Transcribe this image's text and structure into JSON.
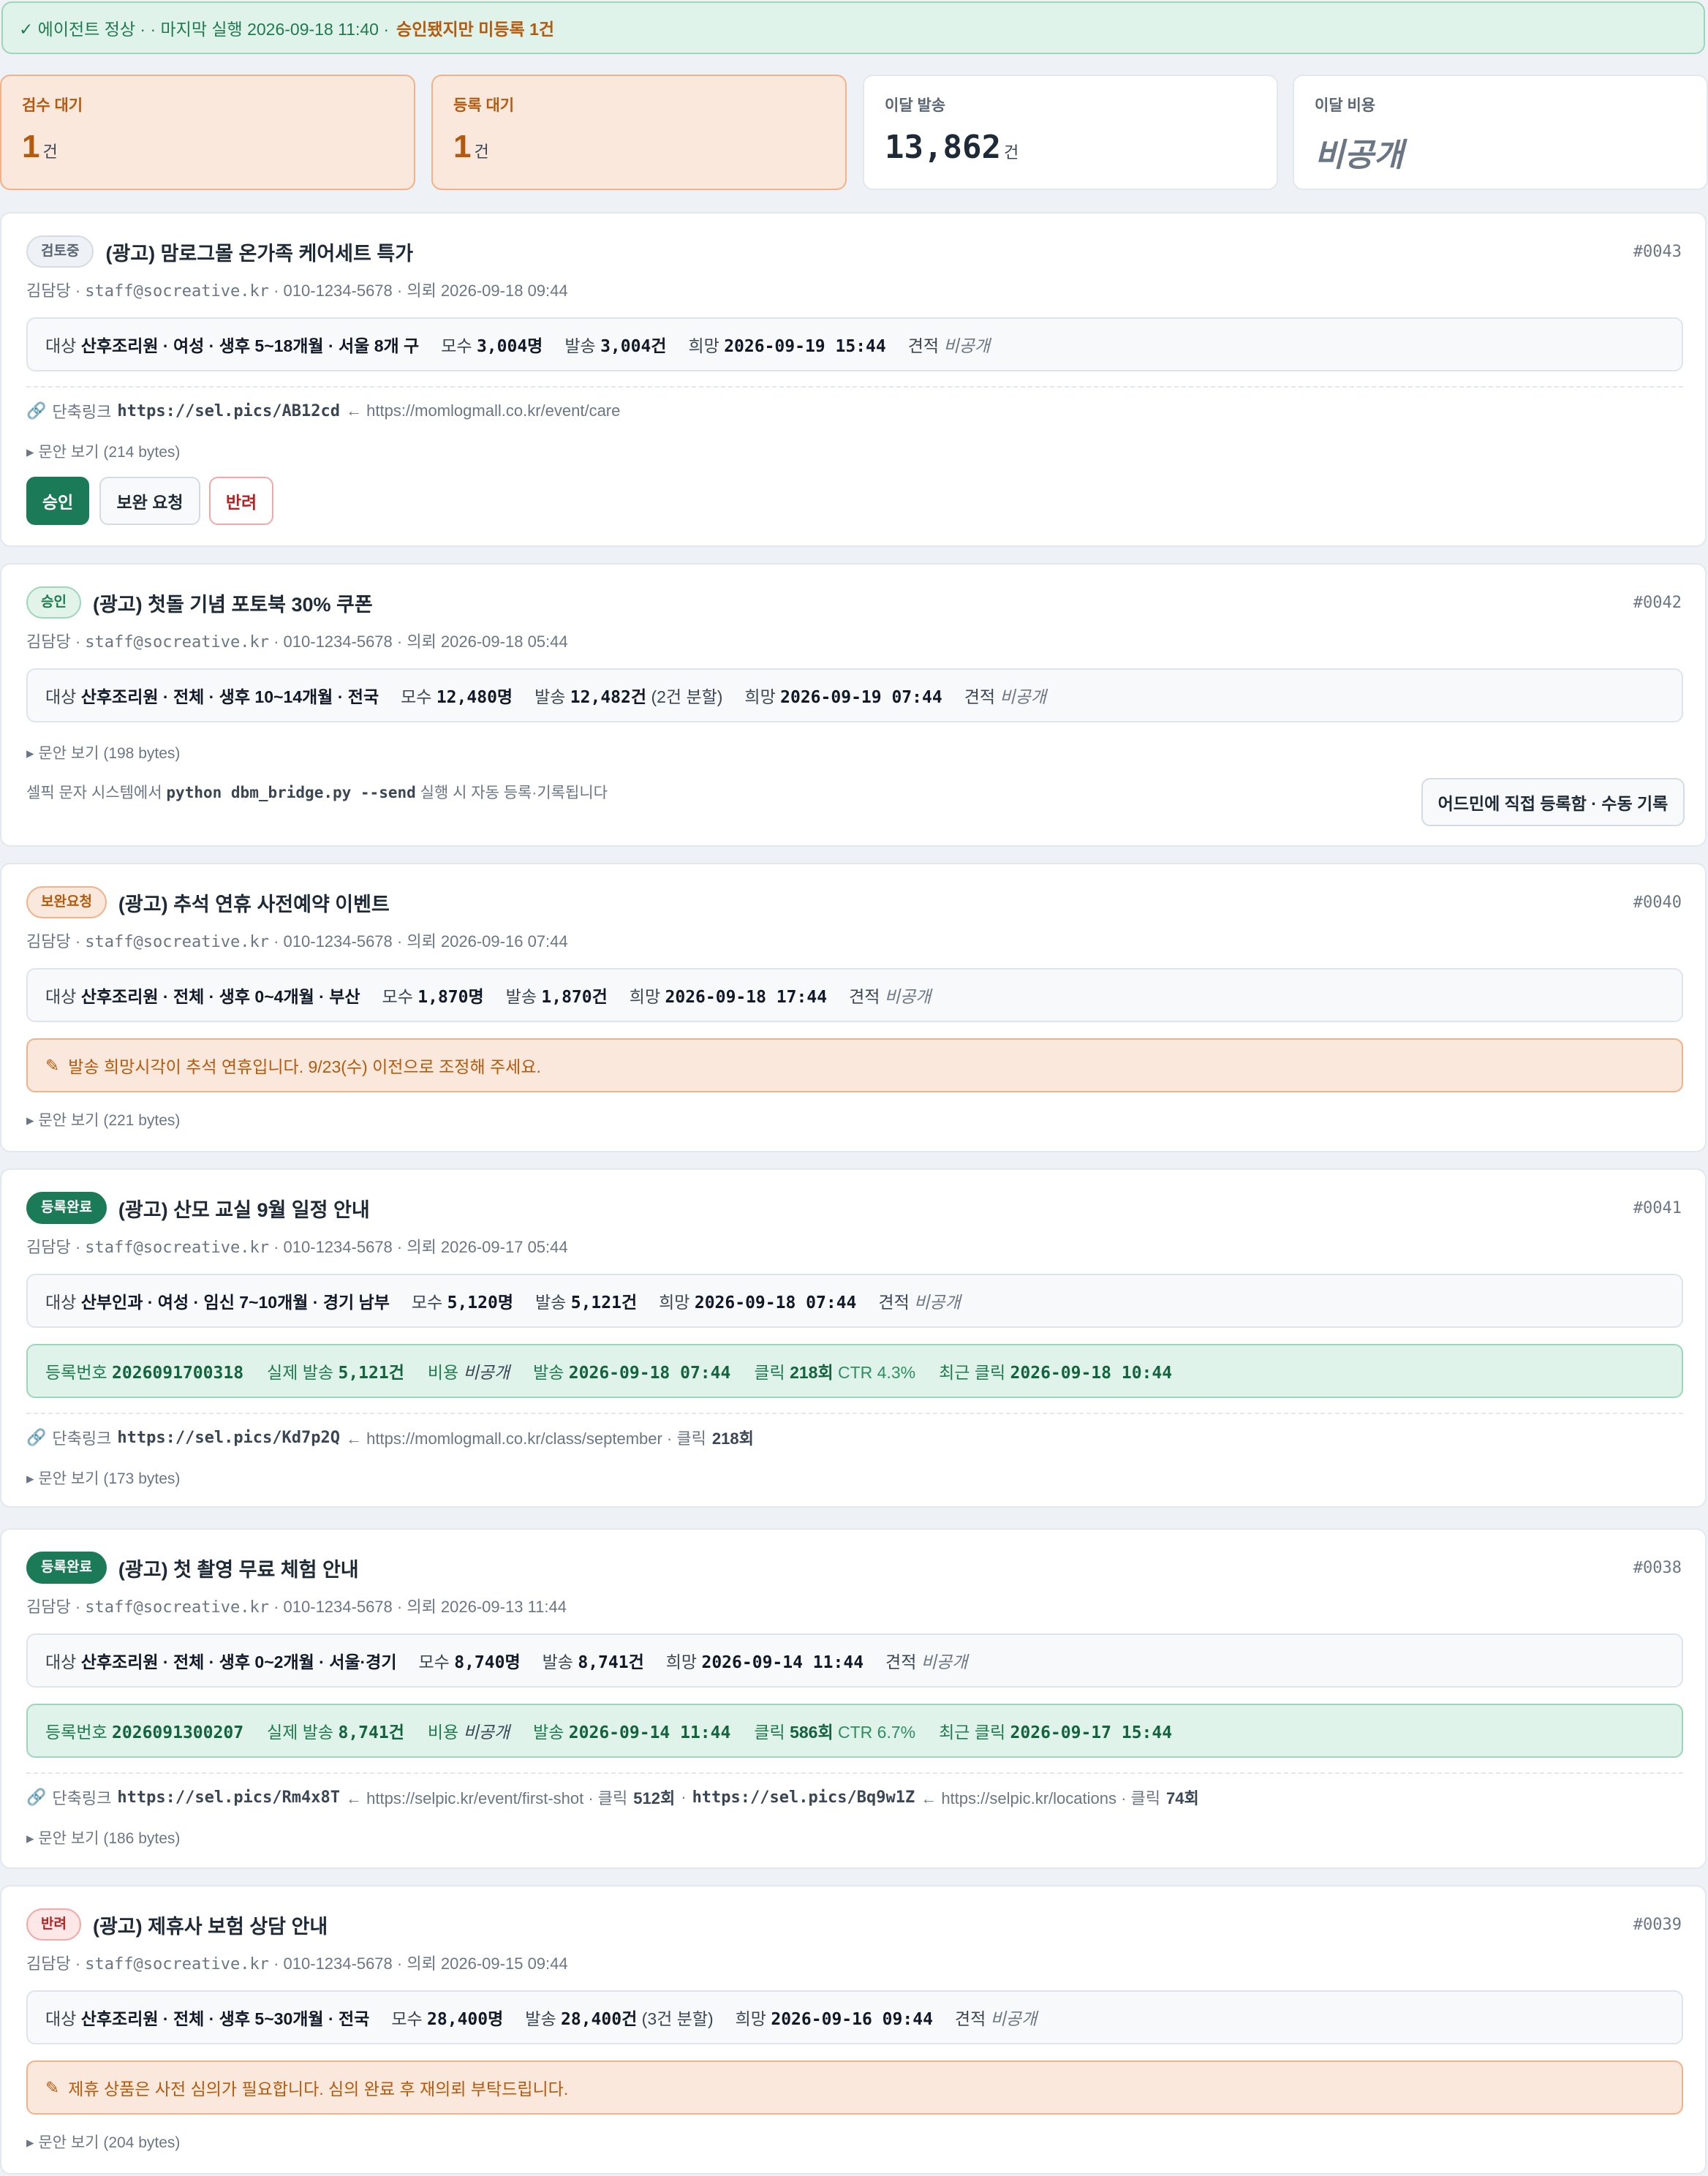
{
  "banner": {
    "check_icon": "check-icon",
    "status": "✓ 에이전트 정상 · · 마지막 실행 2026-09-18 11:40 ·",
    "warning": "승인됐지만 미등록 1건"
  },
  "stats": [
    {
      "label": "검수 대기",
      "value": "1",
      "unit": "건"
    },
    {
      "label": "등록 대기",
      "value": "1",
      "unit": "건"
    },
    {
      "label": "이달 발송",
      "value": "13,862",
      "unit": "건"
    },
    {
      "label": "이달 비용",
      "value": "비공개"
    }
  ],
  "cards": [
    {
      "badge": "검토중",
      "title": "(광고) 맘로그몰 온가족 케어세트 특가",
      "id": "#0043",
      "meta_pre": "김담당 ·",
      "meta_email": "staff@socreative.kr",
      "meta_post": "· 010-1234-5678 · 의뢰 2026-09-18 09:44",
      "target_label": "대상",
      "target": "산후조리원 · 여성 · 생후 5~18개월 · 서울 8개 구",
      "pop_label": "모수",
      "pop": "3,004명",
      "send_label": "발송",
      "send": "3,004건",
      "wish_label": "희망",
      "wish": "2026-09-19 15:44",
      "quote_label": "견적",
      "quote": "비공개",
      "link_label": "단축링크",
      "short": "https://sel.pics/AB12cd",
      "long": "← https://momlogmall.co.kr/event/care",
      "text_toggle": "▸ 문안 보기 (214 bytes)",
      "btn_approve": "승인",
      "btn_revise": "보완 요청",
      "btn_reject": "반려"
    },
    {
      "badge": "승인",
      "title": "(광고) 첫돌 기념 포토북 30% 쿠폰",
      "id": "#0042",
      "meta_pre": "김담당 ·",
      "meta_email": "staff@socreative.kr",
      "meta_post": "· 010-1234-5678 · 의뢰 2026-09-18 05:44",
      "target_label": "대상",
      "target": "산후조리원 · 전체 · 생후 10~14개월 · 전국",
      "pop_label": "모수",
      "pop": "12,480명",
      "send_label": "발송",
      "send": "12,482건",
      "send_note": "(2건 분할)",
      "wish_label": "희망",
      "wish": "2026-09-19 07:44",
      "quote_label": "견적",
      "quote": "비공개",
      "text_toggle": "▸ 문안 보기 (198 bytes)",
      "auto_pre": "셀픽 문자 시스템에서",
      "auto_cmd": "python dbm_bridge.py --send",
      "auto_post": "실행 시 자동 등록·기록됩니다",
      "btn_manual": "어드민에 직접 등록함 · 수동 기록"
    },
    {
      "badge": "보완요청",
      "title": "(광고) 추석 연휴 사전예약 이벤트",
      "id": "#0040",
      "meta_pre": "김담당 ·",
      "meta_email": "staff@socreative.kr",
      "meta_post": "· 010-1234-5678 · 의뢰 2026-09-16 07:44",
      "target_label": "대상",
      "target": "산후조리원 · 전체 · 생후 0~4개월 · 부산",
      "pop_label": "모수",
      "pop": "1,870명",
      "send_label": "발송",
      "send": "1,870건",
      "wish_label": "희망",
      "wish": "2026-09-18 17:44",
      "quote_label": "견적",
      "quote": "비공개",
      "note_icon": "pencil-icon",
      "note": "발송 희망시각이 추석 연휴입니다. 9/23(수) 이전으로 조정해 주세요.",
      "text_toggle": "▸ 문안 보기 (221 bytes)"
    },
    {
      "badge": "등록완료",
      "title": "(광고) 산모 교실 9월 일정 안내",
      "id": "#0041",
      "meta_pre": "김담당 ·",
      "meta_email": "staff@socreative.kr",
      "meta_post": "· 010-1234-5678 · 의뢰 2026-09-17 05:44",
      "target_label": "대상",
      "target": "산부인과 · 여성 · 임신 7~10개월 · 경기 남부",
      "pop_label": "모수",
      "pop": "5,120명",
      "send_label": "발송",
      "send": "5,121건",
      "wish_label": "희망",
      "wish": "2026-09-18 07:44",
      "quote_label": "견적",
      "quote": "비공개",
      "reg_label": "등록번호",
      "reg": "2026091700318",
      "actual_label": "실제 발송",
      "actual": "5,121건",
      "cost_label": "비용",
      "cost": "비공개",
      "sent_label": "발송",
      "sent": "2026-09-18 07:44",
      "click_label": "클릭",
      "click": "218회",
      "ctr": "CTR 4.3%",
      "last_label": "최근 클릭",
      "last": "2026-09-18 10:44",
      "link_label": "단축링크",
      "short": "https://sel.pics/Kd7p2Q",
      "long": "← https://momlogmall.co.kr/class/september · 클릭",
      "clicks": "218회",
      "text_toggle": "▸ 문안 보기 (173 bytes)"
    },
    {
      "badge": "등록완료",
      "title": "(광고) 첫 촬영 무료 체험 안내",
      "id": "#0038",
      "meta_pre": "김담당 ·",
      "meta_email": "staff@socreative.kr",
      "meta_post": "· 010-1234-5678 · 의뢰 2026-09-13 11:44",
      "target_label": "대상",
      "target": "산후조리원 · 전체 · 생후 0~2개월 · 서울·경기",
      "pop_label": "모수",
      "pop": "8,740명",
      "send_label": "발송",
      "send": "8,741건",
      "wish_label": "희망",
      "wish": "2026-09-14 11:44",
      "quote_label": "견적",
      "quote": "비공개",
      "reg_label": "등록번호",
      "reg": "2026091300207",
      "actual_label": "실제 발송",
      "actual": "8,741건",
      "cost_label": "비용",
      "cost": "비공개",
      "sent_label": "발송",
      "sent": "2026-09-14 11:44",
      "click_label": "클릭",
      "click": "586회",
      "ctr": "CTR 6.7%",
      "last_label": "최근 클릭",
      "last": "2026-09-17 15:44",
      "link_label": "단축링크",
      "short": "https://sel.pics/Rm4x8T",
      "long": "← https://selpic.kr/event/first-shot · 클릭",
      "clicks": "512회",
      "sep": "·",
      "short2": "https://sel.pics/Bq9w1Z",
      "long2": "← https://selpic.kr/locations · 클릭",
      "clicks2": "74회",
      "text_toggle": "▸ 문안 보기 (186 bytes)"
    },
    {
      "badge": "반려",
      "title": "(광고) 제휴사 보험 상담 안내",
      "id": "#0039",
      "meta_pre": "김담당 ·",
      "meta_email": "staff@socreative.kr",
      "meta_post": "· 010-1234-5678 · 의뢰 2026-09-15 09:44",
      "target_label": "대상",
      "target": "산후조리원 · 전체 · 생후 5~30개월 · 전국",
      "pop_label": "모수",
      "pop": "28,400명",
      "send_label": "발송",
      "send": "28,400건",
      "send_note": "(3건 분할)",
      "wish_label": "희망",
      "wish": "2026-09-16 09:44",
      "quote_label": "견적",
      "quote": "비공개",
      "note_icon": "pencil-icon",
      "note": "제휴 상품은 사전 심의가 필요합니다. 심의 완료 후 재의뢰 부탁드립니다.",
      "text_toggle": "▸ 문안 보기 (204 bytes)"
    }
  ],
  "colors": {
    "accent_green": "#1b7a57",
    "warn_orange": "#b45a0c",
    "danger_red": "#b42323"
  }
}
